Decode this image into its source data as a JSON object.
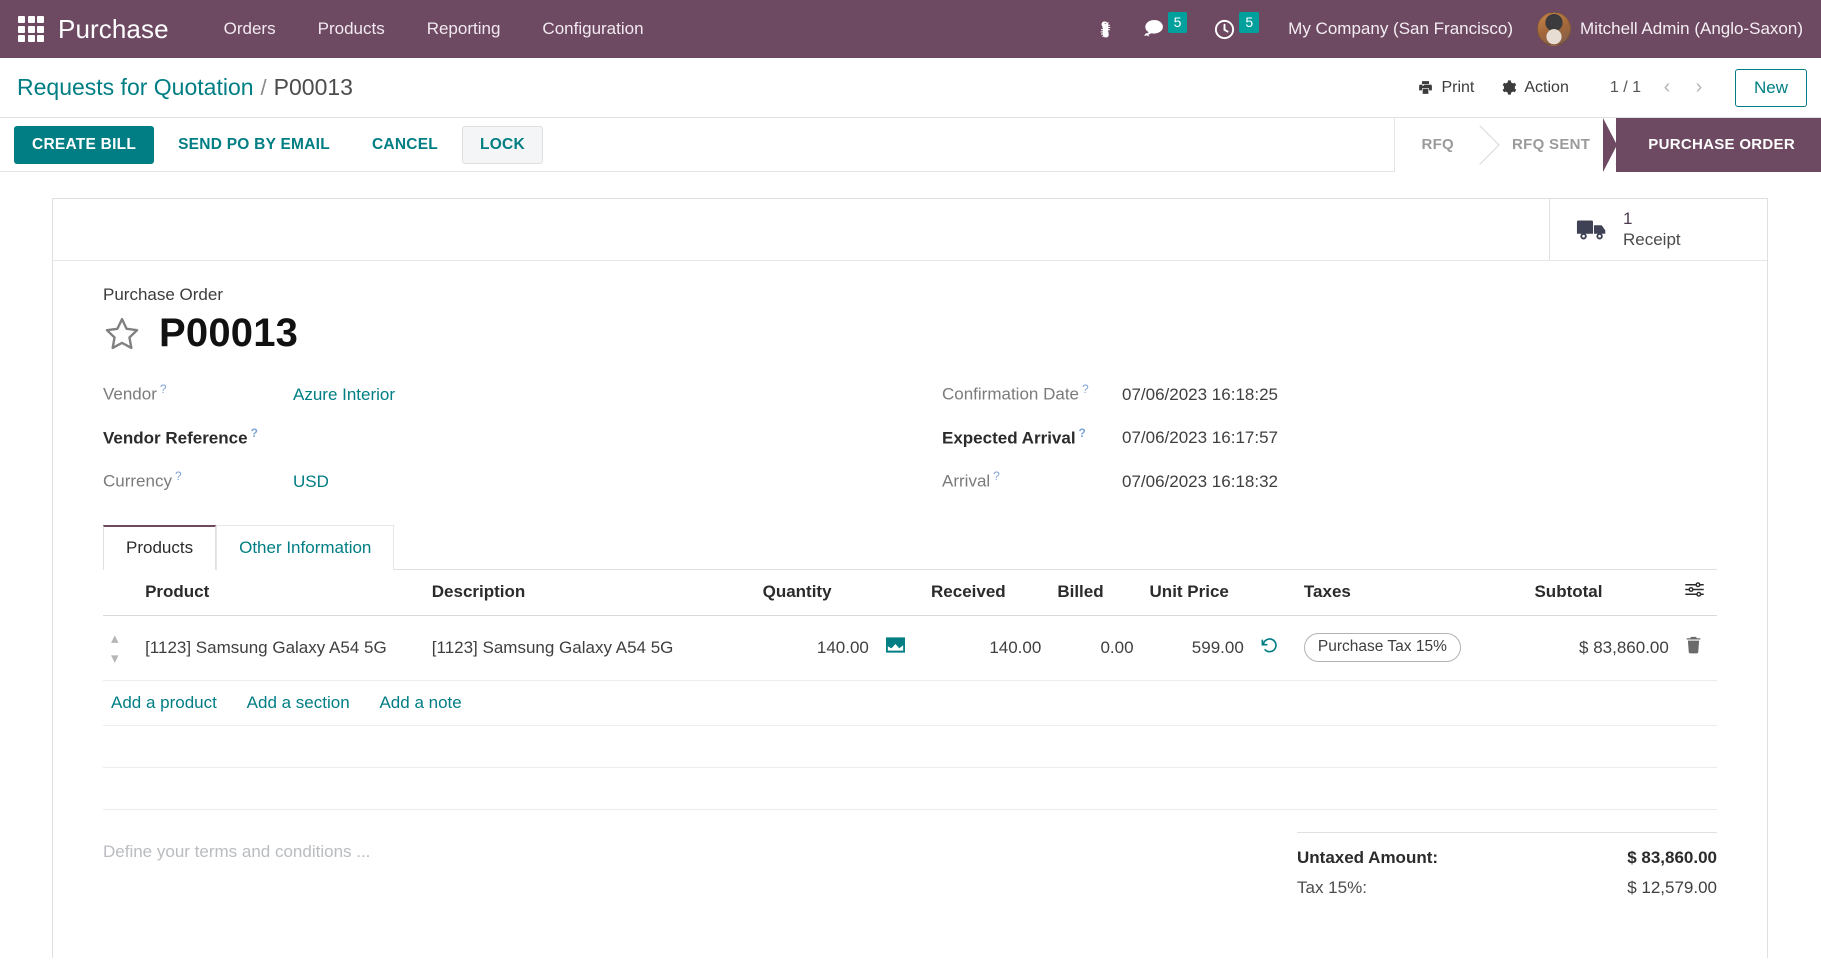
{
  "navbar": {
    "apps_icon": "apps-grid-icon",
    "brand": "Purchase",
    "menu": [
      {
        "label": "Orders"
      },
      {
        "label": "Products"
      },
      {
        "label": "Reporting"
      },
      {
        "label": "Configuration"
      }
    ],
    "bug_icon": "bug-icon",
    "messages": {
      "icon": "chat-bubble-icon",
      "count": "5"
    },
    "activities": {
      "icon": "clock-icon",
      "count": "5"
    },
    "company": "My Company (San Francisco)",
    "user": "Mitchell Admin (Anglo-Saxon)",
    "avatar_icon": "user-avatar"
  },
  "controlpanel": {
    "breadcrumb_parent": "Requests for Quotation",
    "breadcrumb_sep": "/",
    "breadcrumb_current": "P00013",
    "print_label": "Print",
    "print_icon": "printer-icon",
    "action_label": "Action",
    "action_icon": "gear-icon",
    "pager": "1 / 1",
    "prev_icon": "chevron-left-icon",
    "next_icon": "chevron-right-icon",
    "new_label": "New"
  },
  "statusbar": {
    "buttons": [
      {
        "label": "CREATE BILL",
        "style": "primary"
      },
      {
        "label": "SEND PO BY EMAIL",
        "style": "plain"
      },
      {
        "label": "CANCEL",
        "style": "plain"
      },
      {
        "label": "LOCK",
        "style": "boxed"
      }
    ],
    "stages": [
      {
        "label": "RFQ",
        "active": false
      },
      {
        "label": "RFQ SENT",
        "active": false
      },
      {
        "label": "PURCHASE ORDER",
        "active": true
      }
    ]
  },
  "smart_buttons": [
    {
      "icon": "truck-icon",
      "value": "1",
      "label": "Receipt"
    }
  ],
  "record": {
    "form_subtitle": "Purchase Order",
    "star_icon": "star-outline-icon",
    "name": "P00013",
    "left_fields": [
      {
        "label": "Vendor",
        "help": "?",
        "value": "Azure Interior",
        "link": true,
        "bold": false
      },
      {
        "label": "Vendor Reference",
        "help": "?",
        "value": "",
        "link": false,
        "bold": true
      },
      {
        "label": "Currency",
        "help": "?",
        "value": "USD",
        "link": true,
        "bold": false
      }
    ],
    "right_fields": [
      {
        "label": "Confirmation Date",
        "help": "?",
        "value": "07/06/2023 16:18:25",
        "bold": false
      },
      {
        "label": "Expected Arrival",
        "help": "?",
        "value": "07/06/2023 16:17:57",
        "bold": true
      },
      {
        "label": "Arrival",
        "help": "?",
        "value": "07/06/2023 16:18:32",
        "bold": false
      }
    ]
  },
  "tabs": [
    {
      "label": "Products",
      "active": true
    },
    {
      "label": "Other Information",
      "active": false
    }
  ],
  "lines_table": {
    "columns": [
      "Product",
      "Description",
      "Quantity",
      "Received",
      "Billed",
      "Unit Price",
      "Taxes",
      "Subtotal"
    ],
    "optional_columns_icon": "column-settings-icon",
    "rows": [
      {
        "handle_icon": "drag-handle-icon",
        "product": "[1123] Samsung Galaxy A54 5G",
        "description": "[1123] Samsung Galaxy A54 5G",
        "quantity": "140.00",
        "quantity_icon": "forecast-chart-icon",
        "received": "140.00",
        "billed": "0.00",
        "unit_price": "599.00",
        "price_icon": "reset-history-icon",
        "taxes": "Purchase Tax 15%",
        "subtotal": "$ 83,860.00",
        "delete_icon": "trash-icon"
      }
    ],
    "add_links": [
      {
        "label": "Add a product"
      },
      {
        "label": "Add a section"
      },
      {
        "label": "Add a note"
      }
    ]
  },
  "footer": {
    "terms_placeholder": "Define your terms and conditions ...",
    "totals": [
      {
        "label": "Untaxed Amount:",
        "value": "$ 83,860.00",
        "strong": true
      },
      {
        "label": "Tax 15%:",
        "value": "$ 12,579.00",
        "strong": false
      }
    ]
  },
  "colors": {
    "brand_purple": "#6d4962",
    "accent_teal": "#017e84",
    "badge_teal": "#00a09d"
  }
}
